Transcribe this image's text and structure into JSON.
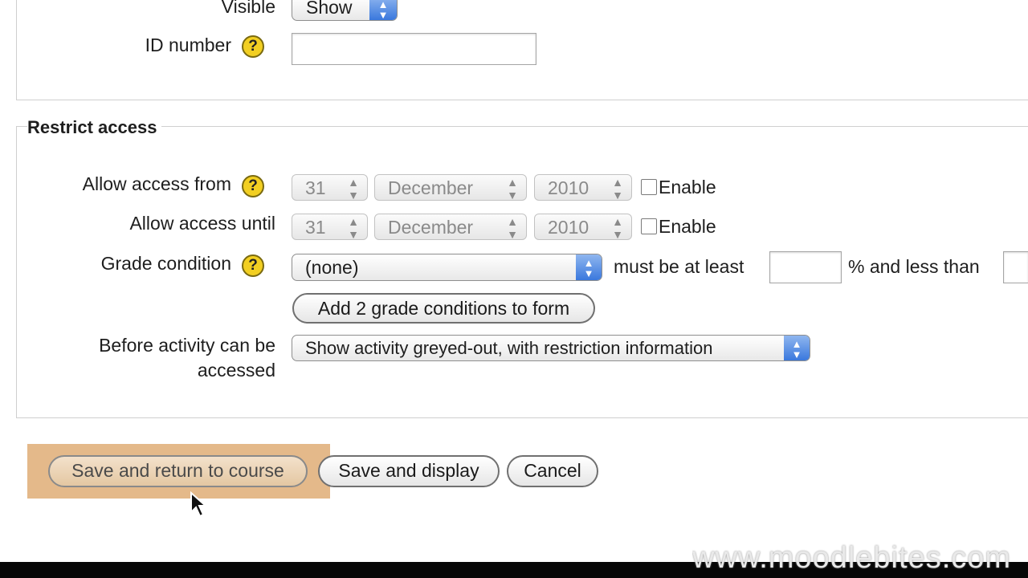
{
  "top": {
    "visible_label": "Visible",
    "visible_value": "Show",
    "id_number_label": "ID number",
    "id_number_value": ""
  },
  "restrict": {
    "legend": "Restrict access",
    "from": {
      "label": "Allow access from",
      "day": "31",
      "month": "December",
      "year": "2010",
      "enable_label": "Enable",
      "enabled": false
    },
    "until": {
      "label": "Allow access until",
      "day": "31",
      "month": "December",
      "year": "2010",
      "enable_label": "Enable",
      "enabled": false
    },
    "grade": {
      "label": "Grade condition",
      "select_value": "(none)",
      "min_text": "must be at least",
      "min_value": "",
      "max_text": "% and less than",
      "max_value": ""
    },
    "add_button": "Add 2 grade conditions to form",
    "before": {
      "label_line1": "Before activity can be",
      "label_line2": "accessed",
      "select_value": "Show activity greyed-out, with restriction information"
    }
  },
  "buttons": {
    "save_return": "Save and return to course",
    "save_display": "Save and display",
    "cancel": "Cancel"
  },
  "watermark": "www.moodlebites.com",
  "colors": {
    "highlight": "#e4b98a",
    "help_icon": "#f2cf22",
    "select_accent": "#3a78dd"
  }
}
